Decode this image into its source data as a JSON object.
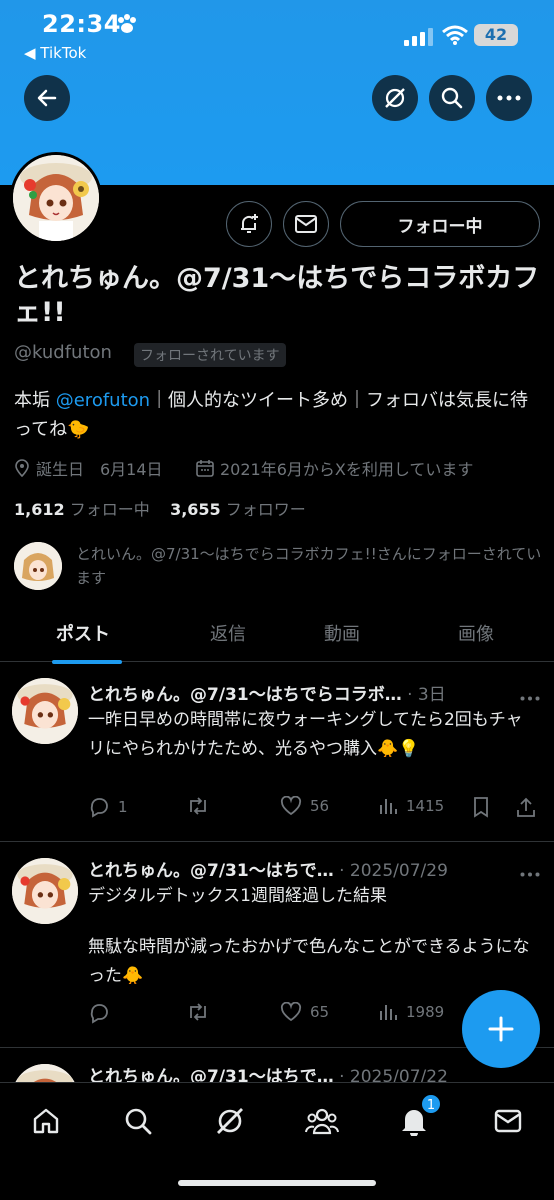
{
  "status_bar": {
    "time": "22:34",
    "back_app": "◀ TikTok",
    "battery": "42"
  },
  "profile": {
    "name": "とれちゅん。@7/31〜はちでらコラボカフェ!!",
    "handle": "@kudfuton",
    "follows_you_badge": "フォローされています",
    "follow_button": "フォロー中",
    "bio_prefix": "本垢 ",
    "bio_link": "@erofuton",
    "bio_rest": "｜個人的なツイート多め｜フォロバは気長に待ってね🐤",
    "birthday": "誕生日　6月14日",
    "joined": "2021年6月からXを利用しています",
    "following_count": "1,612",
    "following_label": "フォロー中",
    "followers_count": "3,655",
    "followers_label": "フォロワー",
    "followed_by_text": "とれいん。@7/31〜はちでらコラボカフェ!!さんにフォローされています"
  },
  "tabs": [
    {
      "label": "ポスト",
      "active": true
    },
    {
      "label": "返信"
    },
    {
      "label": "動画"
    },
    {
      "label": "画像"
    }
  ],
  "posts": [
    {
      "name": "とれちゅん。@7/31〜はちでらコラボ…",
      "date": "· 3日",
      "text": "一昨日早めの時間帯に夜ウォーキングしてたら2回もチャリにやられかけたため、光るやつ購入🐥💡",
      "replies": "1",
      "reposts": "",
      "likes": "56",
      "views": "1415"
    },
    {
      "name": "とれちゅん。@7/31〜はちで…",
      "date": "· 2025/07/29",
      "text_line1": "デジタルデトックス1週間経過した結果",
      "text_line2": "無駄な時間が減ったおかげで色んなことができるようになった🐥",
      "replies": "",
      "reposts": "",
      "likes": "65",
      "views": "1989"
    },
    {
      "name": "とれちゅん。@7/31〜はちで…",
      "date": "· 2025/07/22"
    }
  ],
  "notifications_badge": "1",
  "colors": {
    "accent": "#1d9bf0",
    "background": "#000000",
    "muted": "#71767b",
    "text": "#e7e9ea"
  }
}
